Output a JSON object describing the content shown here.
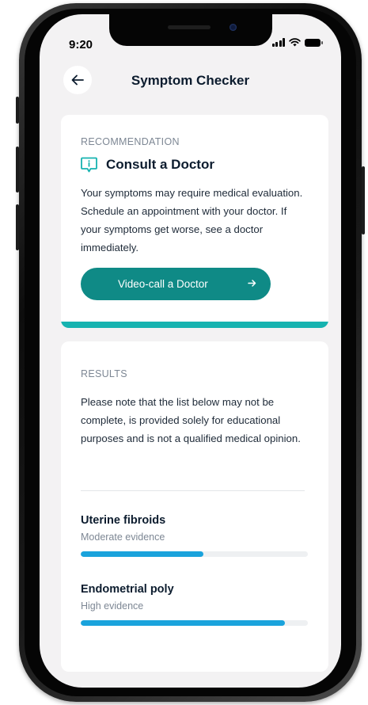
{
  "status_bar": {
    "time": "9:20"
  },
  "header": {
    "title": "Symptom Checker",
    "back_icon": "arrow-left-icon"
  },
  "recommendation": {
    "section_label": "RECOMMENDATION",
    "icon": "info-chat-icon",
    "title": "Consult a Doctor",
    "body": "Your symptoms may require medical evaluation. Schedule an appointment with your doctor. If your symptoms get worse, see a doctor immediately.",
    "cta_label": "Video-call a Doctor",
    "cta_icon": "arrow-right-icon"
  },
  "results": {
    "section_label": "RESULTS",
    "note": "Please note that the list below may not be complete, is provided solely for educational purposes and is not a qualified medical opinion.",
    "items": [
      {
        "name": "Uterine fibroids",
        "evidence": "Moderate evidence",
        "level": 0.54
      },
      {
        "name": "Endometrial poly",
        "evidence": "High evidence",
        "level": 0.9
      }
    ]
  },
  "colors": {
    "accent_teal": "#16b3b0",
    "button_teal": "#0f8a86",
    "evidence_bar": "#1aa3dc",
    "screen_bg": "#f3f2f3"
  }
}
